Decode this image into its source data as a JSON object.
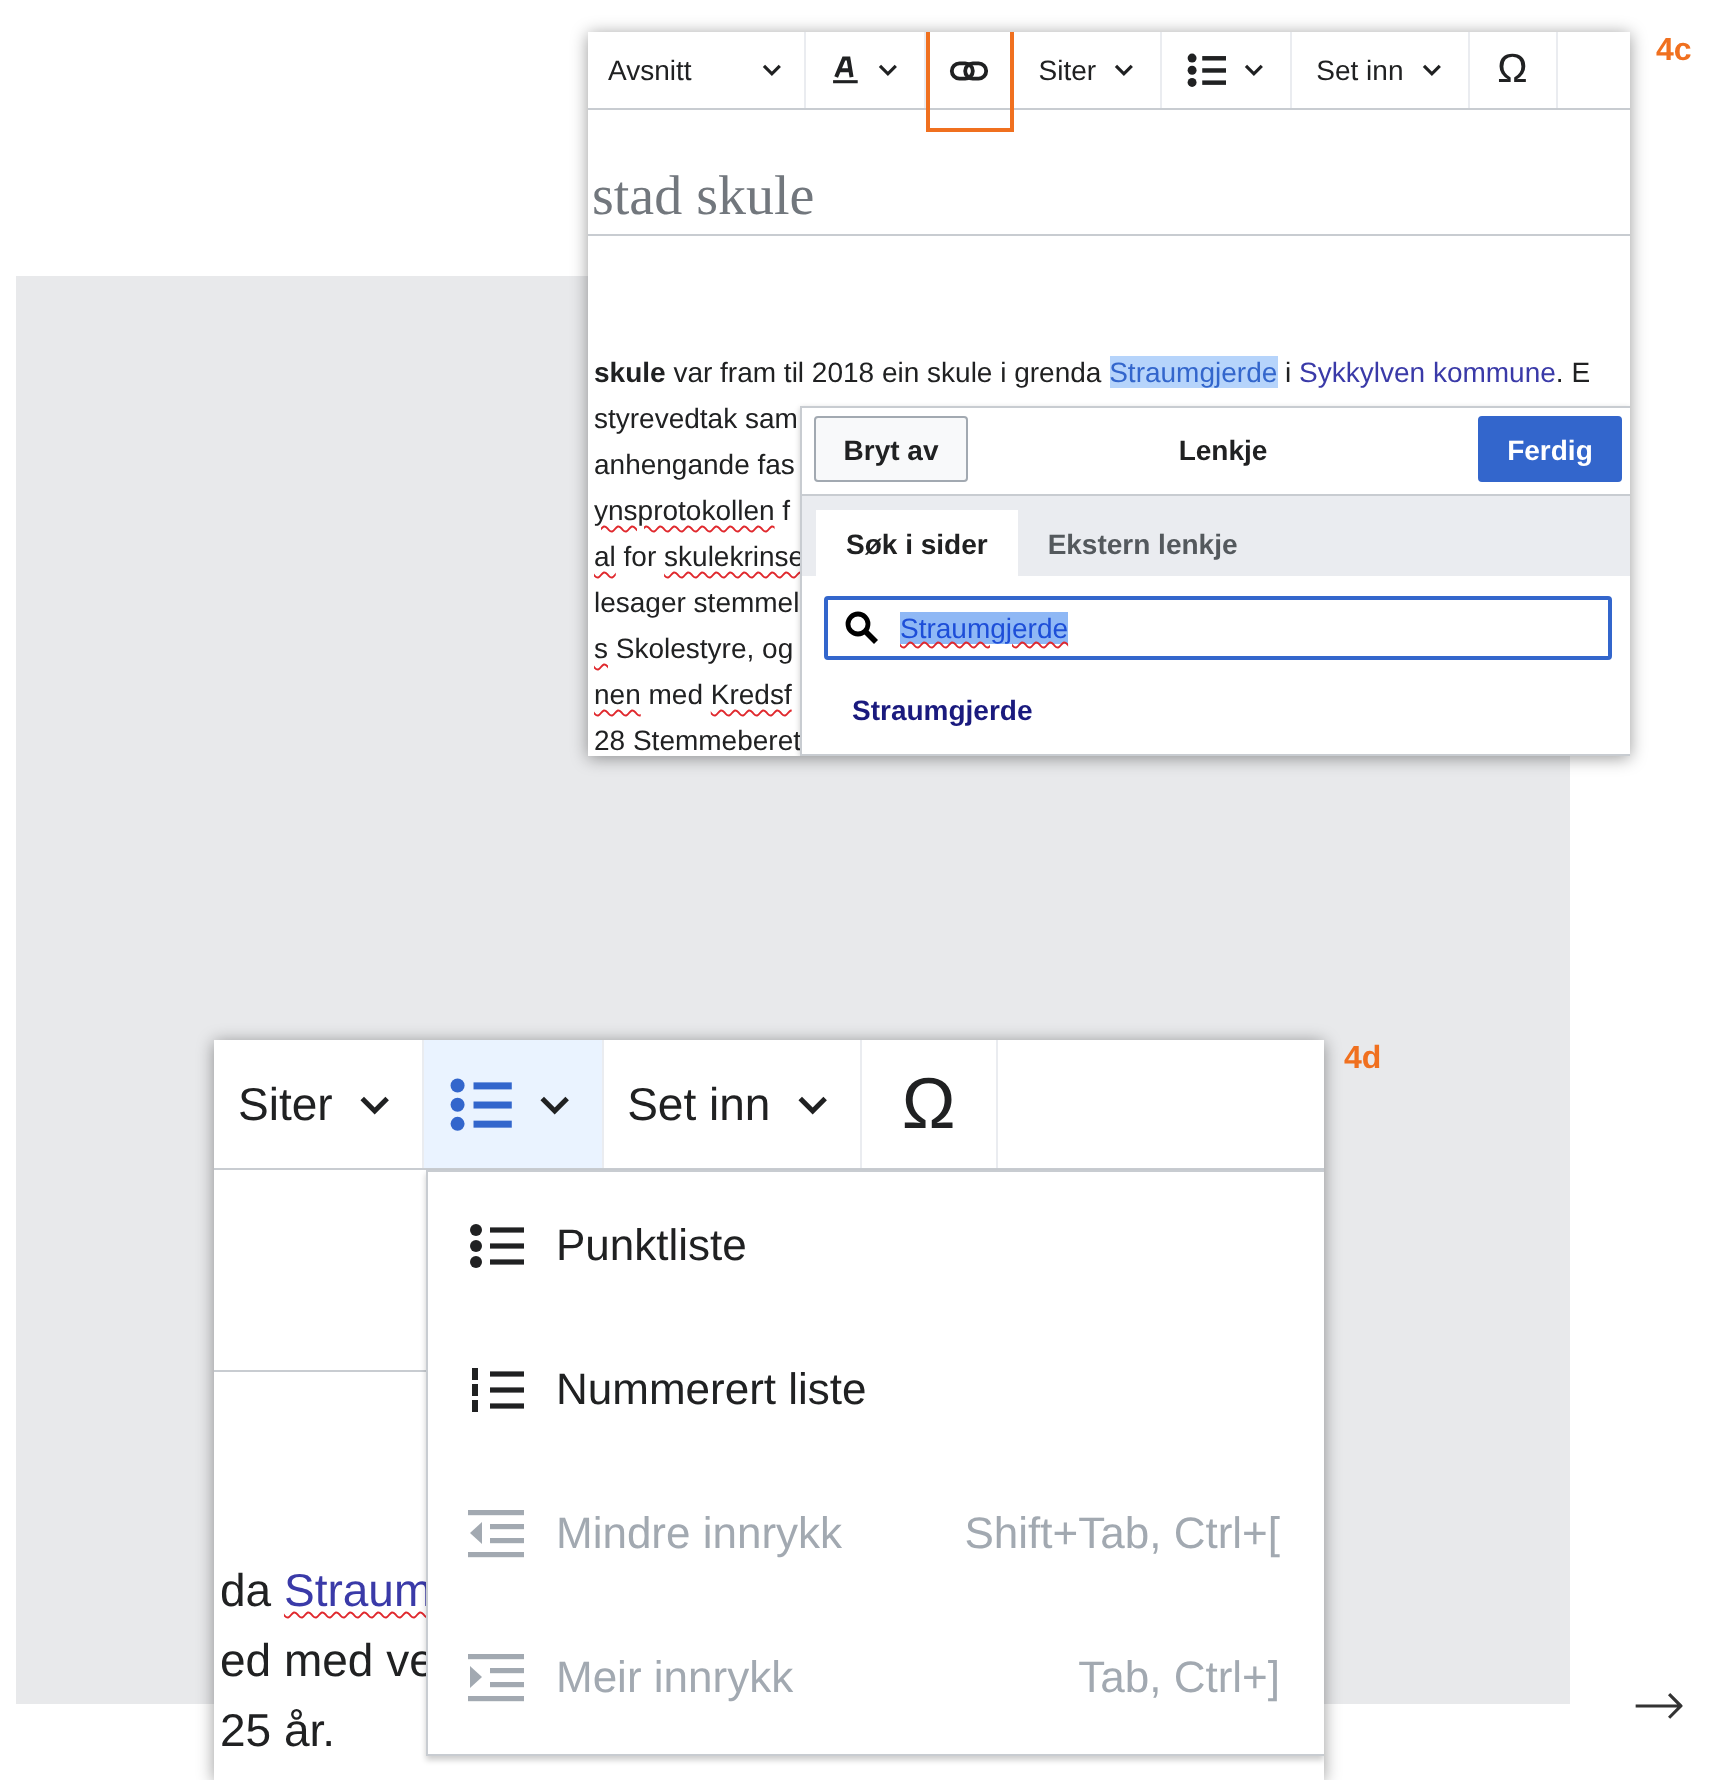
{
  "link_panel": {
    "label": "4c",
    "toolbar": [
      {
        "kind": "format-menu",
        "label": "Avsnitt",
        "highlighted": false
      },
      {
        "kind": "style-menu",
        "highlighted": false
      },
      {
        "kind": "link",
        "highlighted": true
      },
      {
        "kind": "text-menu",
        "label": "Siter",
        "highlighted": false
      },
      {
        "kind": "list-menu",
        "highlighted": false
      },
      {
        "kind": "text-menu",
        "label": "Set inn",
        "highlighted": false
      },
      {
        "kind": "special-chars",
        "label": "Ω",
        "highlighted": false
      }
    ],
    "page_title": "stad skule",
    "paragraph_lines": [
      [
        {
          "kind": "bold",
          "text": "skule"
        },
        {
          "kind": "plain",
          "text": " var fram til 2018 ein skule i grenda "
        },
        {
          "kind": "highlight",
          "text": "Straumgjerde"
        },
        {
          "kind": "plain",
          "text": " i "
        },
        {
          "kind": "link",
          "text": "Sykkylven kommune"
        },
        {
          "kind": "plain",
          "text": ". E"
        }
      ],
      [
        {
          "kind": "plain",
          "text": "styrevedtak sam"
        }
      ],
      [
        {
          "kind": "plain",
          "text": "anhengande fas"
        }
      ],
      [
        {
          "kind": "misspelled",
          "text": "ynsprotokollen"
        },
        {
          "kind": "plain",
          "text": " f"
        }
      ],
      [
        {
          "kind": "misspelled",
          "text": "al"
        },
        {
          "kind": "plain",
          "text": " for "
        },
        {
          "kind": "misspelled",
          "text": "skulekrinse"
        }
      ],
      [
        {
          "kind": "plain",
          "text": "lesager stemmel"
        }
      ],
      [
        {
          "kind": "misspelled",
          "text": "s"
        },
        {
          "kind": "plain",
          "text": " Skolestyre, og"
        }
      ],
      [
        {
          "kind": "misspelled",
          "text": "nen"
        },
        {
          "kind": "plain",
          "text": " med "
        },
        {
          "kind": "misspelled",
          "text": "Kredsf"
        }
      ],
      [
        {
          "kind": "plain",
          "text": "28 Stemmeberet"
        }
      ]
    ],
    "link_dialog": {
      "cancel": "Bryt av",
      "title": "Lenkje",
      "done": "Ferdig",
      "tabs": [
        {
          "label": "Søk i sider",
          "selected": true
        },
        {
          "label": "Ekstern lenkje",
          "selected": false
        }
      ],
      "search": {
        "value": "Straumgjerde"
      },
      "results": [
        "Straumgjerde"
      ]
    }
  },
  "list_panel": {
    "label": "4d",
    "toolbar": [
      {
        "kind": "text-menu",
        "label": "Siter",
        "active": false
      },
      {
        "kind": "list-menu",
        "active": true
      },
      {
        "kind": "text-menu",
        "label": "Set inn",
        "active": false
      },
      {
        "kind": "special-chars",
        "label": "Ω",
        "active": false
      }
    ],
    "content_lines": [
      [
        {
          "kind": "plain",
          "text": "da "
        },
        {
          "kind": "misspelled-link",
          "text": "Straum"
        }
      ],
      [
        {
          "kind": "plain",
          "text": "ed med ve"
        }
      ],
      [
        {
          "kind": "plain",
          "text": "25 år."
        }
      ]
    ],
    "menu": [
      {
        "kind": "bullet",
        "label": "Punktliste",
        "disabled": false
      },
      {
        "kind": "numbered",
        "label": "Nummerert liste",
        "disabled": false
      },
      {
        "kind": "outdent",
        "label": "Mindre innrykk",
        "shortcut": "Shift+Tab, Ctrl+[",
        "disabled": true
      },
      {
        "kind": "indent",
        "label": "Meir innrykk",
        "shortcut": "Tab, Ctrl+]",
        "disabled": true
      }
    ]
  },
  "next_arrow": "→"
}
